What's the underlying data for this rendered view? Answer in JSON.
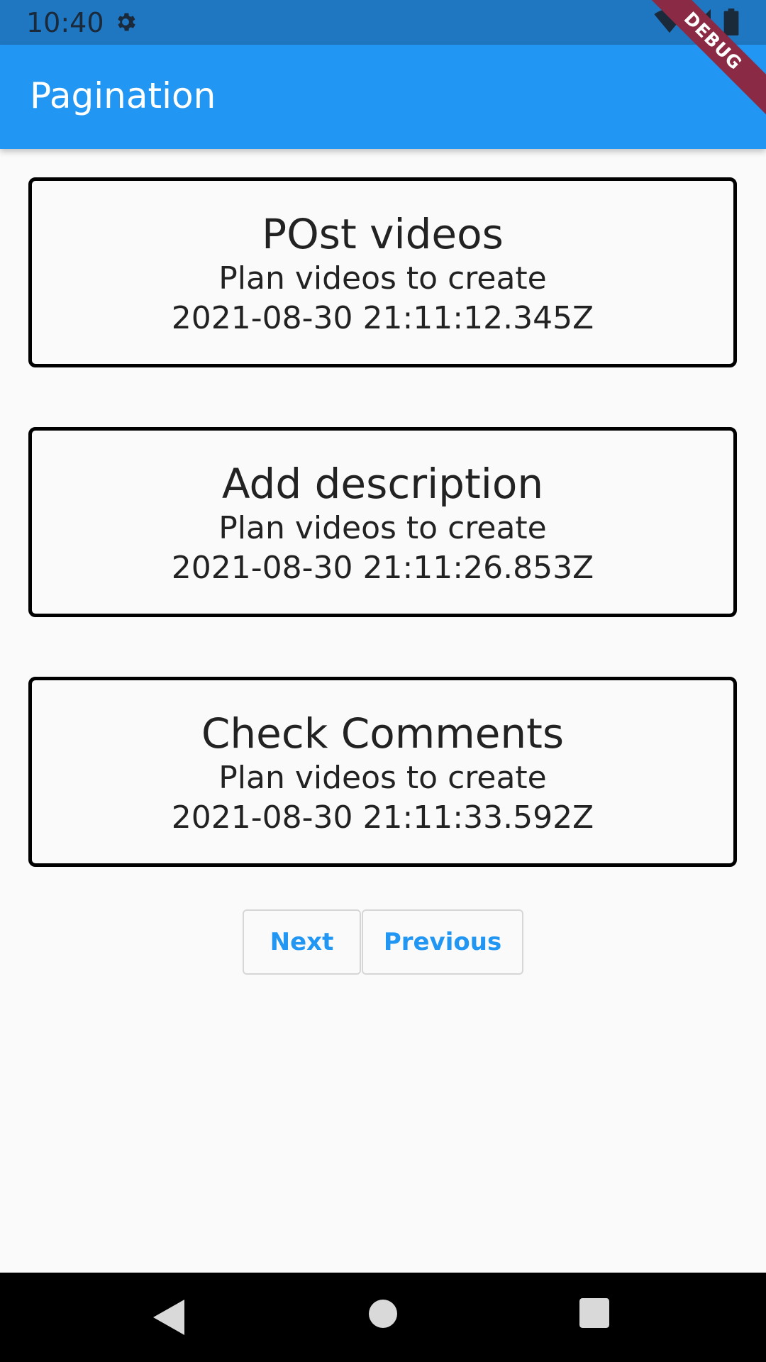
{
  "status_bar": {
    "time": "10:40",
    "icons": [
      "gear-icon",
      "wifi-icon",
      "signal-icon",
      "battery-icon"
    ]
  },
  "app_bar": {
    "title": "Pagination"
  },
  "debug_banner": {
    "label": "DEBUG"
  },
  "cards": [
    {
      "title": "POst videos",
      "description": "Plan videos to create",
      "timestamp": "2021-08-30 21:11:12.345Z"
    },
    {
      "title": "Add description",
      "description": "Plan videos to create",
      "timestamp": "2021-08-30 21:11:26.853Z"
    },
    {
      "title": "Check Comments",
      "description": "Plan videos to create",
      "timestamp": "2021-08-30 21:11:33.592Z"
    }
  ],
  "pagination": {
    "next_label": "Next",
    "previous_label": "Previous"
  },
  "nav_bar": {
    "icons": [
      "back-icon",
      "home-icon",
      "recents-icon"
    ]
  },
  "colors": {
    "status_bar": "#1f76c1",
    "app_bar": "#2196f3",
    "button_text": "#2196f3",
    "debug_banner": "#8a2a44",
    "background": "#fafafa"
  }
}
